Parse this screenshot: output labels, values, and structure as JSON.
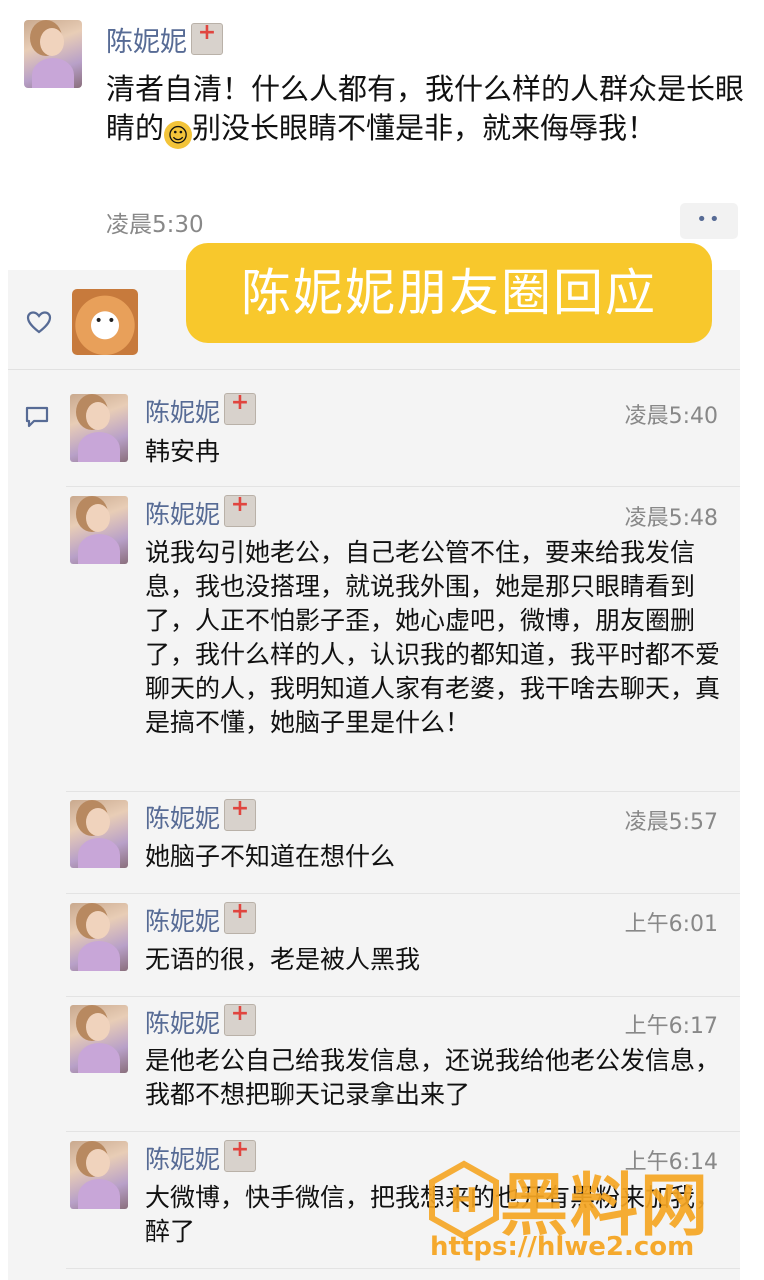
{
  "post": {
    "name": "陈妮妮",
    "text_before_emoji": "清者自清！什么人都有，我什么样的人群众是长眼睛的",
    "text_after_emoji": "别没长眼睛不懂是非，就来侮辱我！",
    "emoji": "smile-emoji",
    "time": "凌晨5:30",
    "more_label": "••"
  },
  "banner": "陈妮妮朋友圈回应",
  "comments": [
    {
      "name": "陈妮妮",
      "time": "凌晨5:40",
      "text": "韩安冉"
    },
    {
      "name": "陈妮妮",
      "time": "凌晨5:48",
      "text": "说我勾引她老公，自己老公管不住，要来给我发信息，我也没搭理，就说我外围，她是那只眼睛看到了，人正不怕影子歪，她心虚吧，微博，朋友圈删了，我什么样的人，认识我的都知道，我平时都不爱聊天的人，我明知道人家有老婆，我干啥去聊天，真是搞不懂，她脑子里是什么！"
    },
    {
      "name": "陈妮妮",
      "time": "凌晨5:57",
      "text": "她脑子不知道在想什么"
    },
    {
      "name": "陈妮妮",
      "time": "上午6:01",
      "text": "无语的很，老是被人黑我"
    },
    {
      "name": "陈妮妮",
      "time": "上午6:17",
      "text": "是他老公自己给我发信息，还说我给他老公发信息，我都不想把聊天记录拿出来了"
    },
    {
      "name": "陈妮妮",
      "time": "上午6:14",
      "text": "大微博，快手微信，把我想来的也开有黑粉来加我，醉了"
    }
  ],
  "watermark": {
    "title": "黑料网",
    "url": "https://hlwe2.com"
  },
  "icons": {
    "like": "heart-icon",
    "comment": "comment-icon",
    "badge": "hospital-badge-icon"
  },
  "colors": {
    "name": "#576b95",
    "banner": "#f8c82c",
    "watermark": "#f6a623"
  }
}
